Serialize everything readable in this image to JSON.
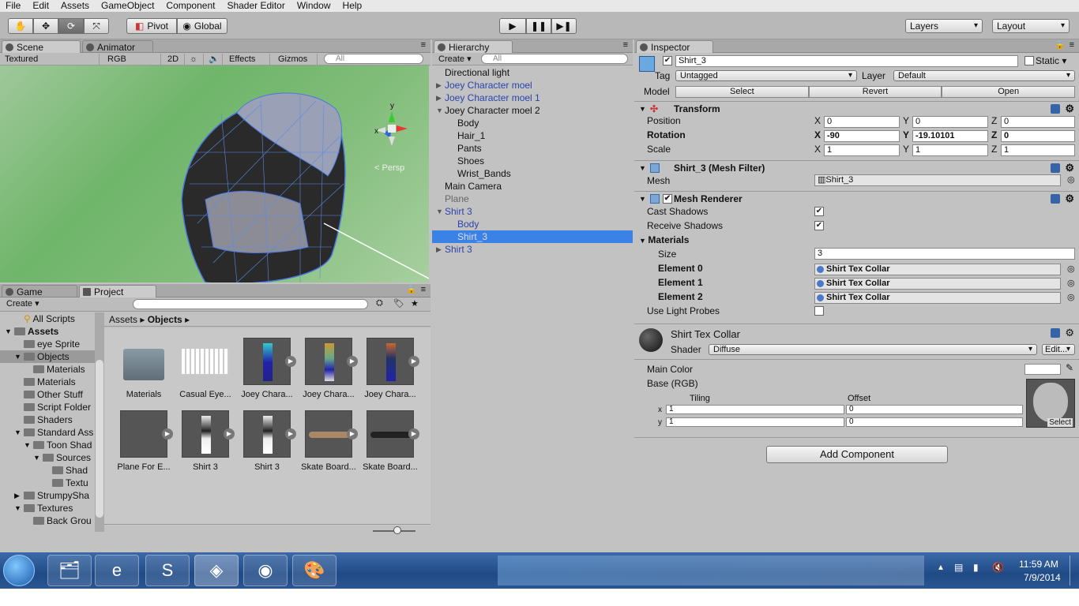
{
  "menu": [
    "File",
    "Edit",
    "Assets",
    "GameObject",
    "Component",
    "Shader Editor",
    "Window",
    "Help"
  ],
  "toolbar": {
    "pivot": "Pivot",
    "global": "Global",
    "layers": "Layers",
    "layout": "Layout"
  },
  "scene": {
    "tab_scene": "Scene",
    "tab_animator": "Animator",
    "render_mode": "Textured",
    "color_mode": "RGB",
    "mode_2d": "2D",
    "effects": "Effects",
    "gizmos": "Gizmos",
    "search_placeholder": "All",
    "persp": "Persp",
    "gizmo_y": "y",
    "gizmo_x": "x"
  },
  "hierarchy": {
    "tab": "Hierarchy",
    "create": "Create",
    "search_placeholder": "All",
    "items": [
      {
        "label": "Directional light",
        "indent": 0,
        "color": "normal",
        "arrow": ""
      },
      {
        "label": "Joey Character moel",
        "indent": 0,
        "color": "blue",
        "arrow": "right"
      },
      {
        "label": "Joey Character moel 1",
        "indent": 0,
        "color": "blue",
        "arrow": "right"
      },
      {
        "label": "Joey Character moel 2",
        "indent": 0,
        "color": "normal",
        "arrow": "down"
      },
      {
        "label": "Body",
        "indent": 1,
        "color": "normal",
        "arrow": ""
      },
      {
        "label": "Hair_1",
        "indent": 1,
        "color": "normal",
        "arrow": ""
      },
      {
        "label": "Pants",
        "indent": 1,
        "color": "normal",
        "arrow": ""
      },
      {
        "label": "Shoes",
        "indent": 1,
        "color": "normal",
        "arrow": ""
      },
      {
        "label": "Wrist_Bands",
        "indent": 1,
        "color": "normal",
        "arrow": ""
      },
      {
        "label": "Main Camera",
        "indent": 0,
        "color": "normal",
        "arrow": ""
      },
      {
        "label": "Plane",
        "indent": 0,
        "color": "grey",
        "arrow": ""
      },
      {
        "label": "Shirt 3",
        "indent": 0,
        "color": "blue",
        "arrow": "down"
      },
      {
        "label": "Body",
        "indent": 1,
        "color": "blue",
        "arrow": ""
      },
      {
        "label": "Shirt_3",
        "indent": 1,
        "color": "selected",
        "arrow": ""
      },
      {
        "label": "Shirt 3",
        "indent": 0,
        "color": "blue",
        "arrow": "right"
      }
    ]
  },
  "inspector": {
    "tab": "Inspector",
    "object_name": "Shirt_3",
    "static": "Static",
    "tag_label": "Tag",
    "tag_value": "Untagged",
    "layer_label": "Layer",
    "layer_value": "Default",
    "model_label": "Model",
    "select": "Select",
    "revert": "Revert",
    "open": "Open",
    "transform": {
      "title": "Transform",
      "position": "Position",
      "rotation": "Rotation",
      "scale": "Scale",
      "pos": [
        "0",
        "0",
        "0"
      ],
      "rot": [
        "-90",
        "-19.10101",
        "0"
      ],
      "scl": [
        "1",
        "1",
        "1"
      ],
      "x": "X",
      "y": "Y",
      "z": "Z"
    },
    "mesh_filter": {
      "title": "Shirt_3 (Mesh Filter)",
      "mesh_label": "Mesh",
      "mesh_value": "Shirt_3"
    },
    "mesh_renderer": {
      "title": "Mesh Renderer",
      "cast": "Cast Shadows",
      "receive": "Receive Shadows",
      "materials": "Materials",
      "size_label": "Size",
      "size_value": "3",
      "e0": "Element 0",
      "e1": "Element 1",
      "e2": "Element 2",
      "mat": "Shirt Tex Collar",
      "light_probes": "Use Light Probes"
    },
    "material": {
      "name": "Shirt Tex Collar",
      "shader_label": "Shader",
      "shader_value": "Diffuse",
      "edit": "Edit...",
      "main_color": "Main Color",
      "base": "Base (RGB)",
      "tiling": "Tiling",
      "offset": "Offset",
      "tx": "1",
      "ty": "1",
      "ox": "0",
      "oy": "0",
      "x": "x",
      "y": "y",
      "select": "Select"
    },
    "add_component": "Add Component"
  },
  "project": {
    "tab_game": "Game",
    "tab_project": "Project",
    "create": "Create",
    "breadcrumb_root": "Assets",
    "breadcrumb_current": "Objects",
    "tree": [
      {
        "label": "All Scripts",
        "indent": 1,
        "arrow": ""
      },
      {
        "label": "Assets",
        "indent": 0,
        "arrow": "down",
        "bold": true
      },
      {
        "label": "eye Sprite",
        "indent": 1,
        "arrow": ""
      },
      {
        "label": "Objects",
        "indent": 1,
        "arrow": "down",
        "sel": true
      },
      {
        "label": "Materials",
        "indent": 2,
        "arrow": ""
      },
      {
        "label": "Materials",
        "indent": 1,
        "arrow": ""
      },
      {
        "label": "Other Stuff",
        "indent": 1,
        "arrow": ""
      },
      {
        "label": "Script Folder",
        "indent": 1,
        "arrow": ""
      },
      {
        "label": "Shaders",
        "indent": 1,
        "arrow": ""
      },
      {
        "label": "Standard Ass",
        "indent": 1,
        "arrow": "down"
      },
      {
        "label": "Toon Shad",
        "indent": 2,
        "arrow": "down"
      },
      {
        "label": "Sources",
        "indent": 3,
        "arrow": "down"
      },
      {
        "label": "Shad",
        "indent": 4,
        "arrow": ""
      },
      {
        "label": "Textu",
        "indent": 4,
        "arrow": ""
      },
      {
        "label": "StrumpySha",
        "indent": 1,
        "arrow": "right"
      },
      {
        "label": "Textures",
        "indent": 1,
        "arrow": "down"
      },
      {
        "label": "Back Grou",
        "indent": 2,
        "arrow": ""
      }
    ],
    "assets": [
      {
        "label": "Materials",
        "kind": "folder"
      },
      {
        "label": "Casual Eye...",
        "kind": "texture"
      },
      {
        "label": "Joey Chara...",
        "kind": "char1"
      },
      {
        "label": "Joey Chara...",
        "kind": "char2"
      },
      {
        "label": "Joey Chara...",
        "kind": "char3"
      },
      {
        "label": "Plane For E...",
        "kind": "plane"
      },
      {
        "label": "Shirt 3",
        "kind": "shirt"
      },
      {
        "label": "Shirt 3",
        "kind": "shirt"
      },
      {
        "label": "Skate Board...",
        "kind": "board1"
      },
      {
        "label": "Skate Board...",
        "kind": "board2"
      }
    ]
  },
  "tray": {
    "time": "11:59 AM",
    "date": "7/9/2014"
  }
}
